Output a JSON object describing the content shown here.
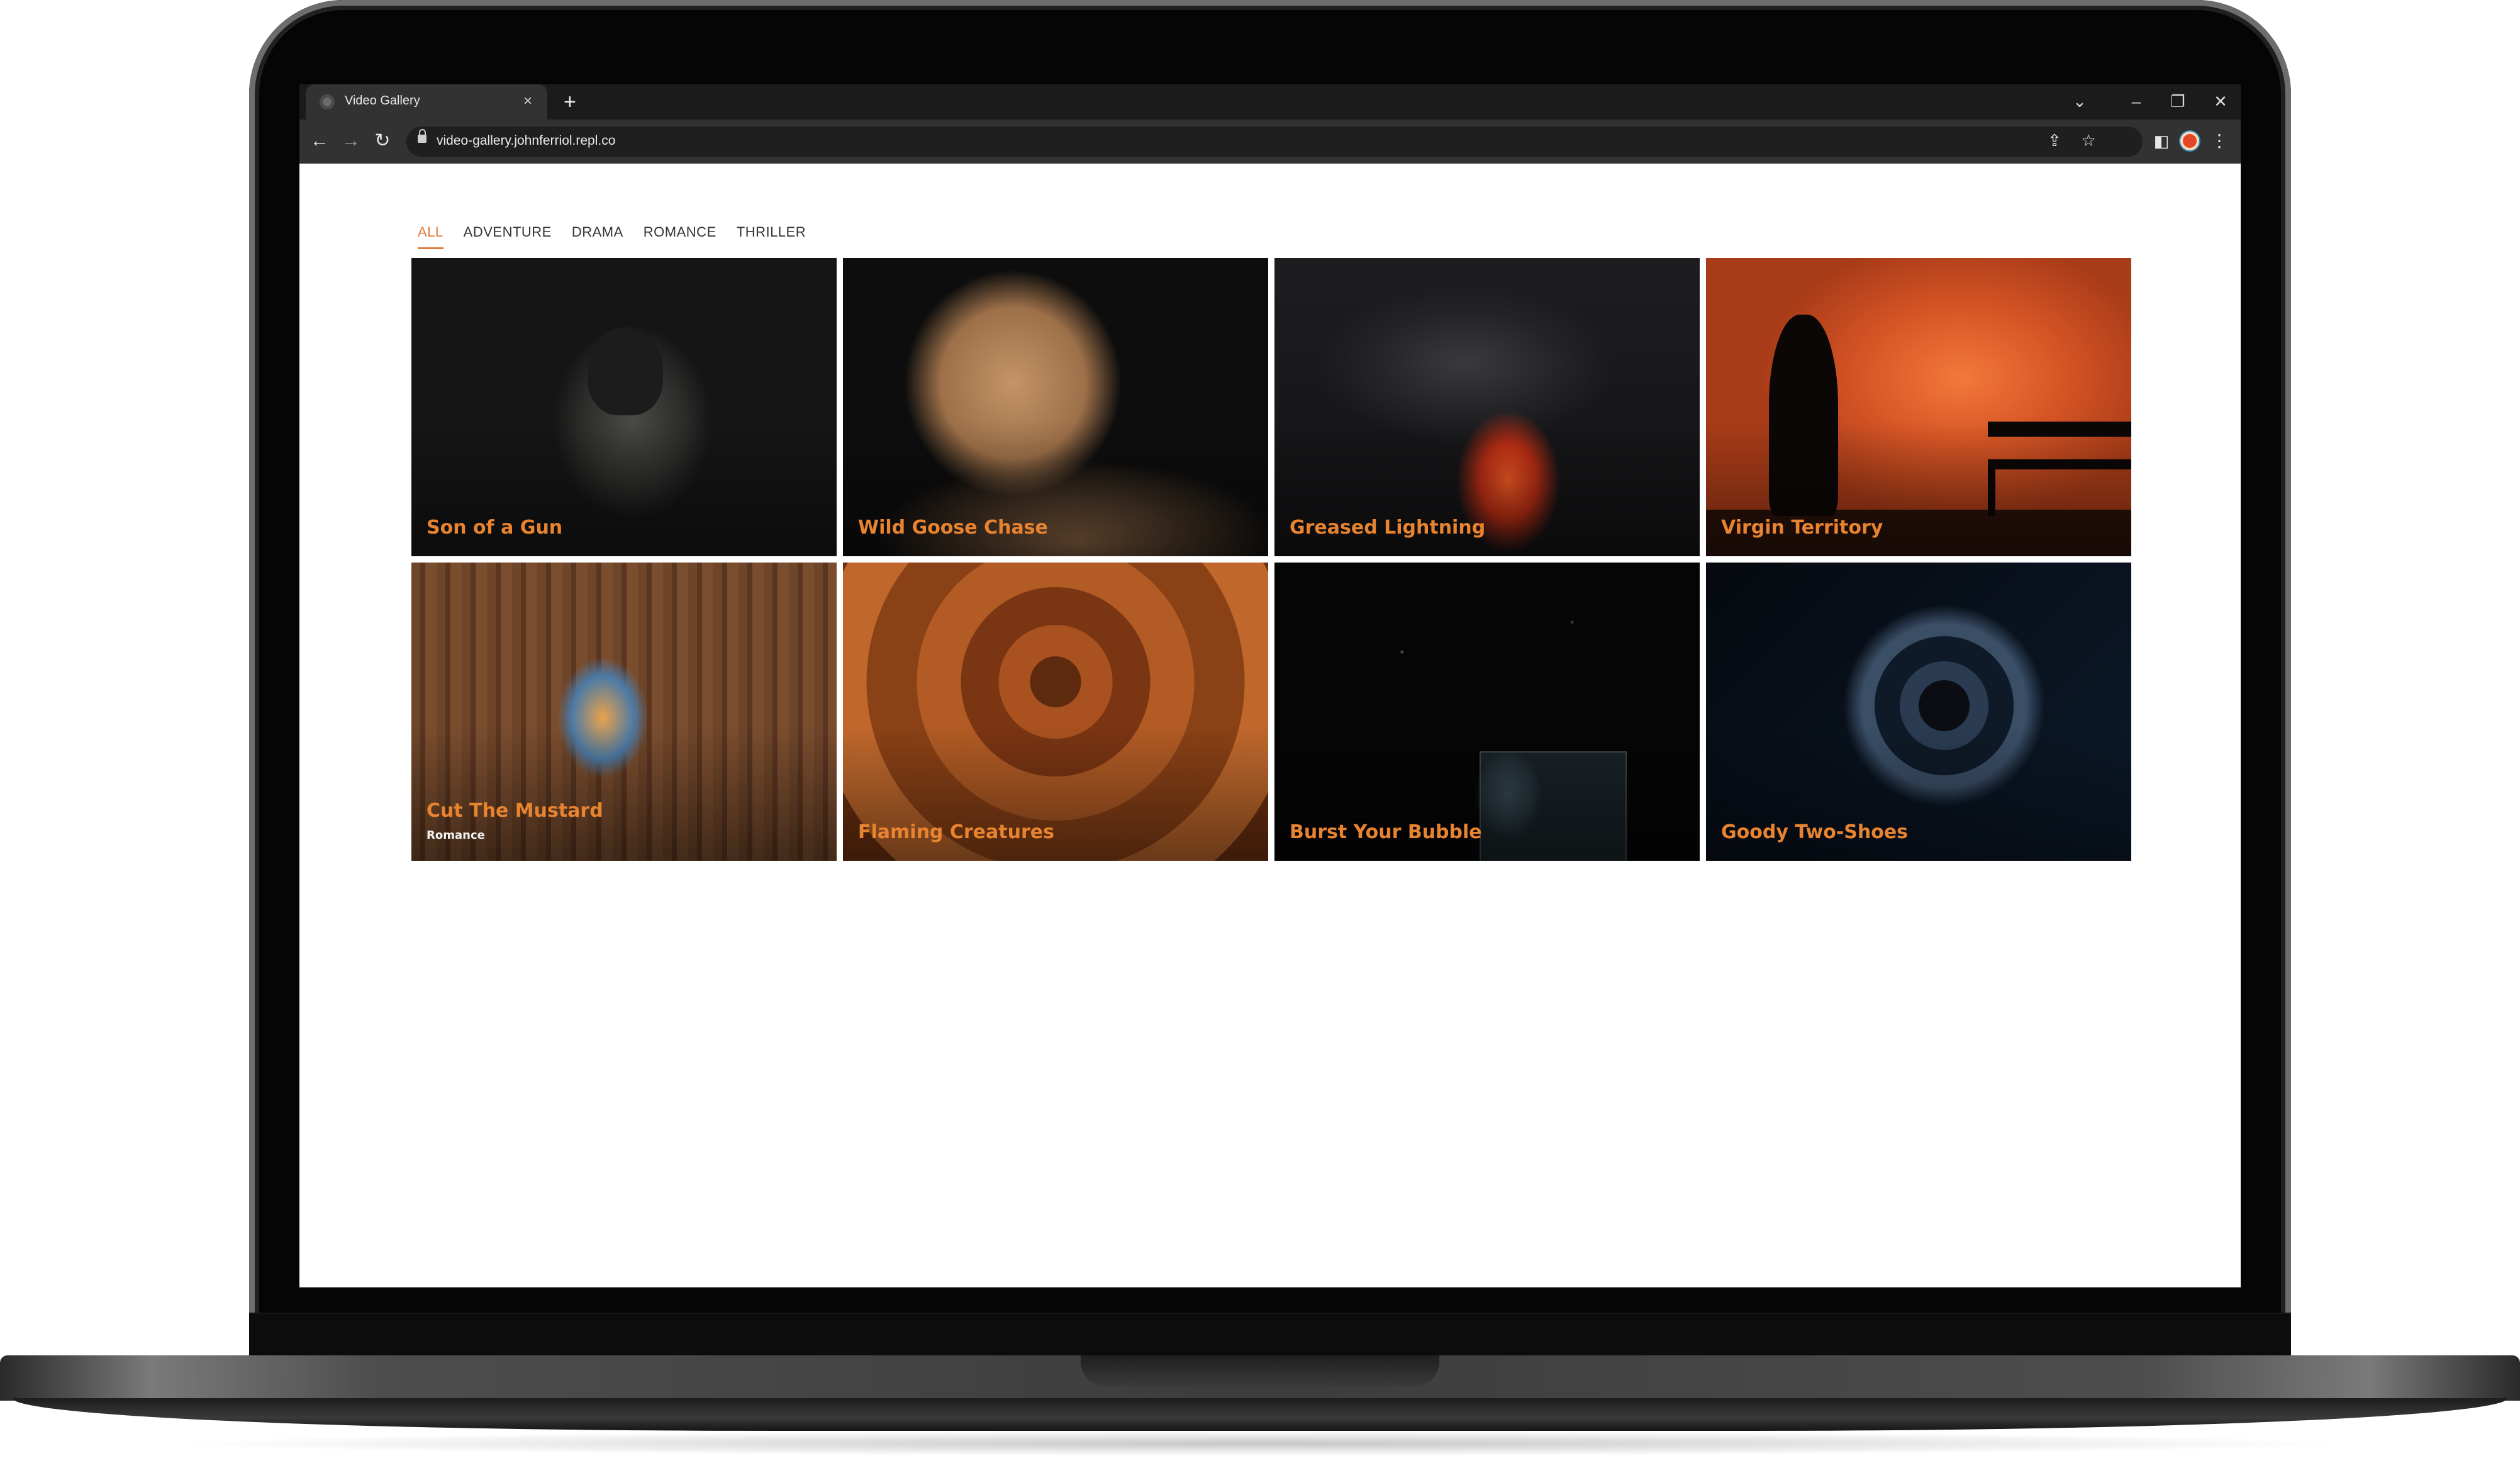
{
  "browser": {
    "tab_title": "Video Gallery",
    "url": "video-gallery.johnferriol.repl.co",
    "new_tab_label": "+",
    "close_tab_label": "×"
  },
  "filters": [
    {
      "label": "ALL",
      "active": true
    },
    {
      "label": "ADVENTURE",
      "active": false
    },
    {
      "label": "DRAMA",
      "active": false
    },
    {
      "label": "ROMANCE",
      "active": false
    },
    {
      "label": "THRILLER",
      "active": false
    }
  ],
  "gallery": {
    "items": [
      {
        "title": "Son of a Gun",
        "genre": ""
      },
      {
        "title": "Wild Goose Chase",
        "genre": ""
      },
      {
        "title": "Greased Lightning",
        "genre": ""
      },
      {
        "title": "Virgin Territory",
        "genre": ""
      },
      {
        "title": "Cut The Mustard",
        "genre": "Romance"
      },
      {
        "title": "Flaming Creatures",
        "genre": ""
      },
      {
        "title": "Burst Your Bubble",
        "genre": ""
      },
      {
        "title": "Goody Two-Shoes",
        "genre": ""
      }
    ]
  },
  "colors": {
    "accent": "#e07b39",
    "card_title": "#e8832f"
  }
}
